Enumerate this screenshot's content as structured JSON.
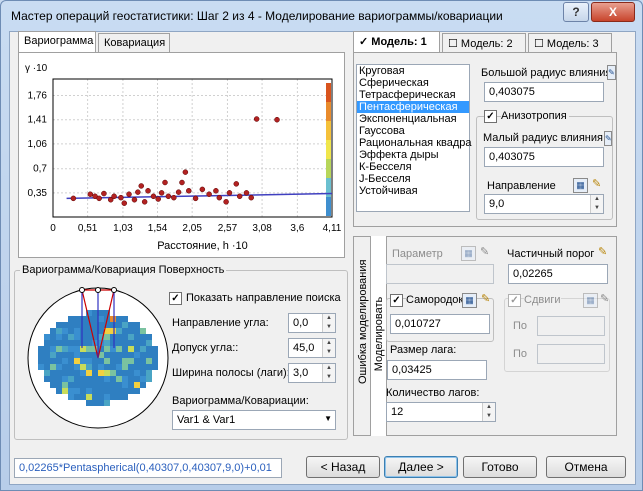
{
  "window": {
    "title": "Мастер операций геостатистики: Шаг 2 из 4 - Моделирование вариограммы/ковариации",
    "help_btn": "?",
    "close_btn": "X"
  },
  "tabs": {
    "variogram": "Вариограмма",
    "covariance": "Ковариация"
  },
  "chart_data": {
    "type": "scatter",
    "title": "",
    "xlabel": "Расстояние, h ·10",
    "ylabel": "γ ·10",
    "xticks": [
      "0",
      "0,51",
      "1,03",
      "1,54",
      "2,05",
      "2,57",
      "3,08",
      "3,6",
      "4,11"
    ],
    "yticks": [
      "0,35",
      "0,7",
      "1,06",
      "1,41",
      "1,76"
    ],
    "xlim": [
      0,
      4.11
    ],
    "ylim": [
      0,
      2.0
    ],
    "points": [
      [
        0.3,
        0.27
      ],
      [
        0.55,
        0.33
      ],
      [
        0.62,
        0.3
      ],
      [
        0.68,
        0.27
      ],
      [
        0.75,
        0.34
      ],
      [
        0.85,
        0.25
      ],
      [
        0.9,
        0.3
      ],
      [
        1.0,
        0.28
      ],
      [
        1.05,
        0.2
      ],
      [
        1.12,
        0.33
      ],
      [
        1.2,
        0.25
      ],
      [
        1.25,
        0.36
      ],
      [
        1.3,
        0.45
      ],
      [
        1.35,
        0.22
      ],
      [
        1.4,
        0.38
      ],
      [
        1.48,
        0.3
      ],
      [
        1.55,
        0.26
      ],
      [
        1.6,
        0.35
      ],
      [
        1.65,
        0.5
      ],
      [
        1.7,
        0.3
      ],
      [
        1.78,
        0.28
      ],
      [
        1.85,
        0.36
      ],
      [
        1.9,
        0.5
      ],
      [
        1.95,
        0.65
      ],
      [
        2.0,
        0.38
      ],
      [
        2.1,
        0.27
      ],
      [
        2.2,
        0.4
      ],
      [
        2.3,
        0.33
      ],
      [
        2.4,
        0.38
      ],
      [
        2.45,
        0.28
      ],
      [
        2.55,
        0.22
      ],
      [
        2.6,
        0.35
      ],
      [
        2.7,
        0.48
      ],
      [
        2.75,
        0.3
      ],
      [
        2.85,
        0.35
      ],
      [
        2.92,
        0.28
      ],
      [
        3.0,
        1.42
      ],
      [
        3.3,
        1.41
      ]
    ],
    "model_line": [
      [
        0.2,
        0.27
      ],
      [
        4.11,
        0.34
      ]
    ]
  },
  "model_tabs": {
    "m1": "Модель: 1",
    "m2": "Модель: 2",
    "m3": "Модель: 3"
  },
  "model_list": [
    "Круговая",
    "Сферическая",
    "Тетрасферическая",
    "Пентасферическая",
    "Экспоненциальная",
    "Гауссова",
    "Рациональная квадра",
    "Эффекта дыры",
    "К-Бесселя",
    "J-Бесселя",
    "Устойчивая"
  ],
  "model_selected": 3,
  "major": {
    "label": "Большой радиус влияния",
    "value": "0,403075"
  },
  "aniso": {
    "label": "Анизотропия"
  },
  "minor": {
    "label": "Малый радиус влияния",
    "value": "0,403075"
  },
  "direction": {
    "label": "Направление",
    "value": "9,0"
  },
  "surface": {
    "title": "Вариограмма/Ковариация Поверхность",
    "show_dir": "Показать направление поиска",
    "angle_dir_label": "Направление угла:",
    "angle_dir": "0,0",
    "angle_tol_label": "Допуск угла::",
    "angle_tol": "45,0",
    "band_label": "Ширина полосы (лаги):",
    "band": "3,0",
    "vario_label": "Вариограмма/Ковариации:",
    "vario_value": "Var1 & Var1"
  },
  "modeling": {
    "error_tab": "Ошибка моделирования",
    "model_tab": "Моделировать",
    "param_label": "Параметр",
    "partial_label": "Частичный порог",
    "partial_value": "0,02265",
    "nugget_label": "Самородок",
    "nugget_value": "0,010727",
    "shifts_label": "Сдвиги",
    "po1": "По",
    "po2": "По",
    "lag_label": "Размер лага:",
    "lag_value": "0,03425",
    "nlags_label": "Количество лагов:",
    "nlags_value": "12"
  },
  "footer": {
    "formula": "0,02265*Pentaspherical(0,40307,0,40307,9,0)+0,01",
    "back": "< Назад",
    "next": "Далее >",
    "finish": "Готово",
    "cancel": "Отмена"
  }
}
